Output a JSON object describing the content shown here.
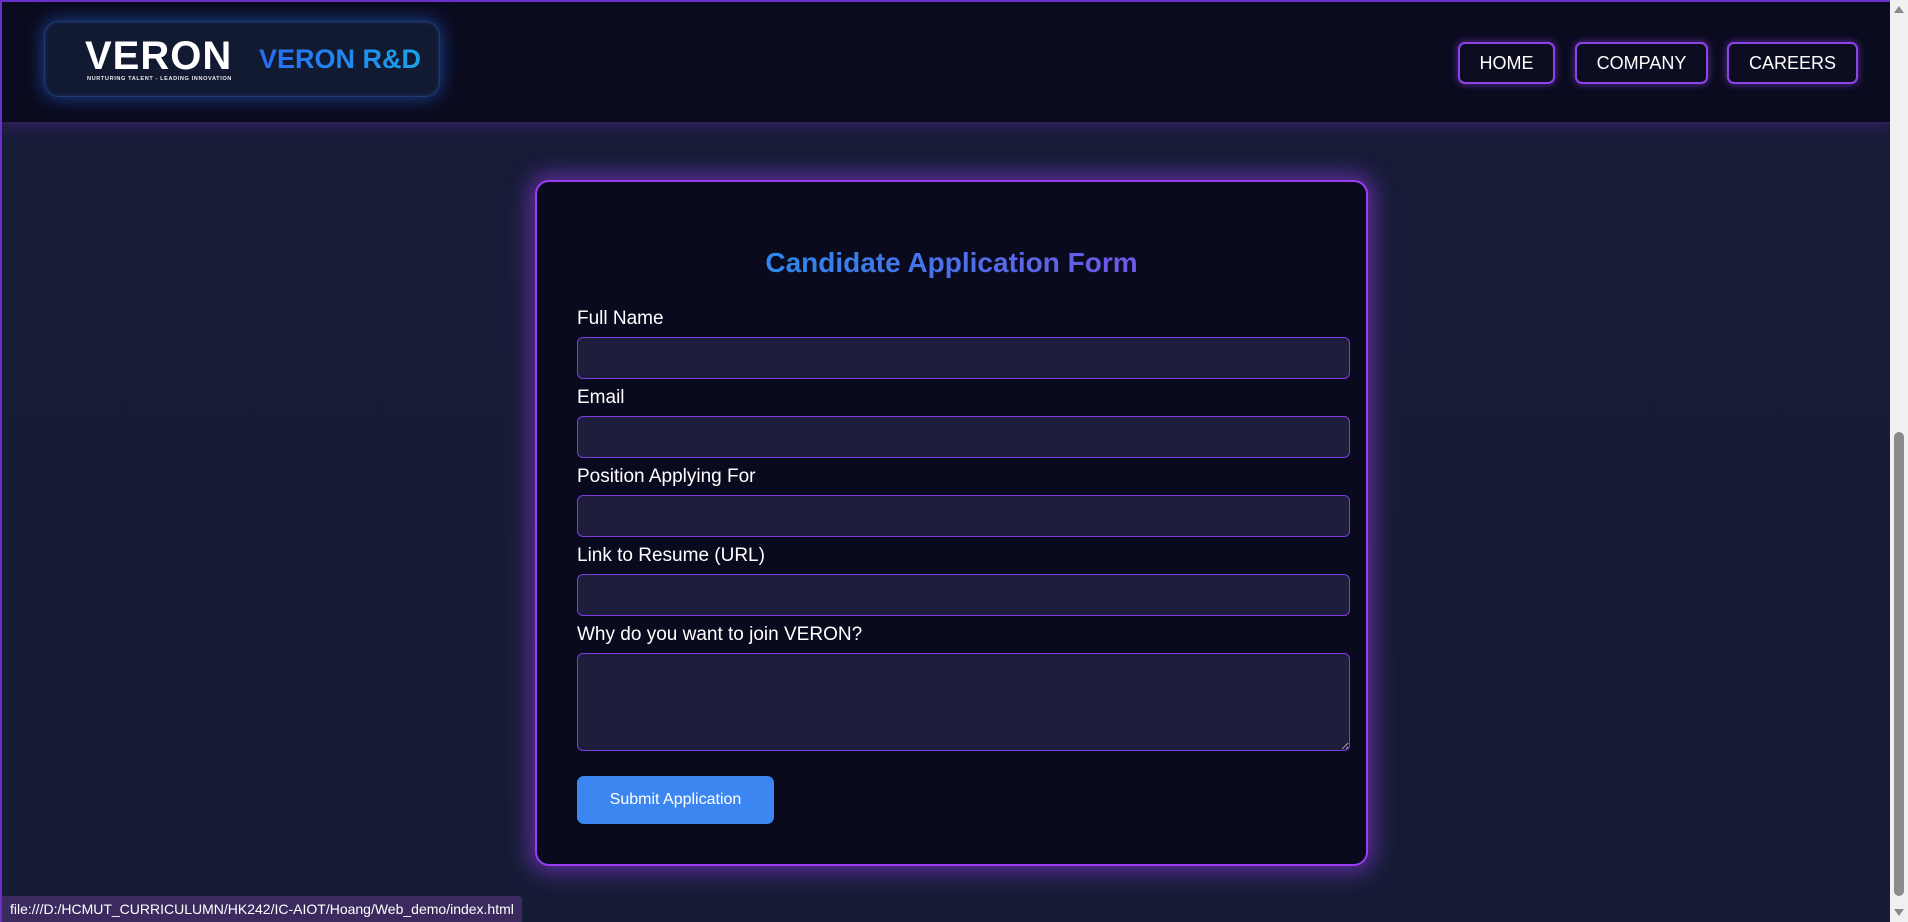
{
  "header": {
    "logo_word": "VERON",
    "logo_tagline": "NURTURING TALENT - LEADING INNOVATION",
    "brand_name": "VERON R&D",
    "nav": {
      "home": "HOME",
      "company": "COMPANY",
      "careers": "CAREERS"
    }
  },
  "form": {
    "title": "Candidate Application Form",
    "fields": {
      "full_name": {
        "label": "Full Name",
        "value": ""
      },
      "email": {
        "label": "Email",
        "value": ""
      },
      "position": {
        "label": "Position Applying For",
        "value": ""
      },
      "resume": {
        "label": "Link to Resume (URL)",
        "value": ""
      },
      "motivation": {
        "label": "Why do you want to join VERON?",
        "value": ""
      }
    },
    "submit_label": "Submit Application"
  },
  "status_bar": {
    "url": "file:///D:/HCMUT_CURRICULUMN/HK242/IC-AIOT/Hoang/Web_demo/index.html"
  },
  "colors": {
    "accent_purple": "#9b3cf0",
    "brand_blue": "#2e7bf0",
    "button_blue": "#3c86f2",
    "background": "#161b33"
  }
}
